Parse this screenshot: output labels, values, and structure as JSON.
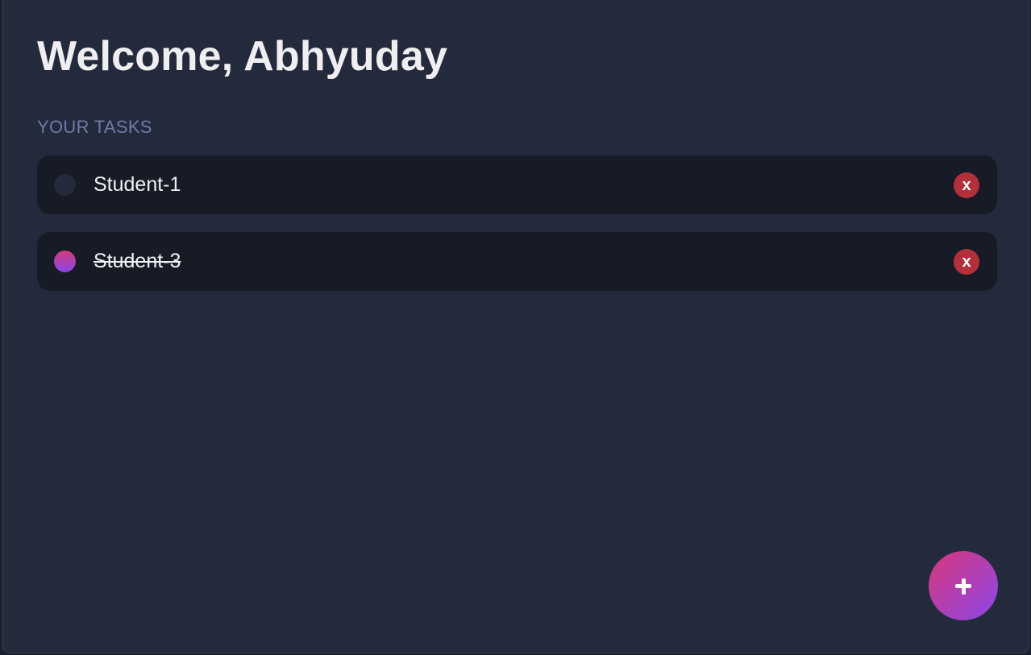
{
  "header": {
    "title": "Welcome, Abhyuday"
  },
  "tasks_section": {
    "label": "YOUR TASKS"
  },
  "tasks": [
    {
      "text": "Student-1",
      "completed": false,
      "delete_label": "x"
    },
    {
      "text": "Student-3",
      "completed": true,
      "delete_label": "x"
    }
  ],
  "icons": {
    "add_button": "plus-icon",
    "checkbox": "circle-check-icon",
    "delete": "close-icon"
  },
  "colors": {
    "background": "#232a3c",
    "task_bg": "#161b26",
    "accent_start": "#d8387a",
    "accent_end": "#8b46e8",
    "delete": "#b3303a",
    "section_label": "#6e7ba7"
  }
}
